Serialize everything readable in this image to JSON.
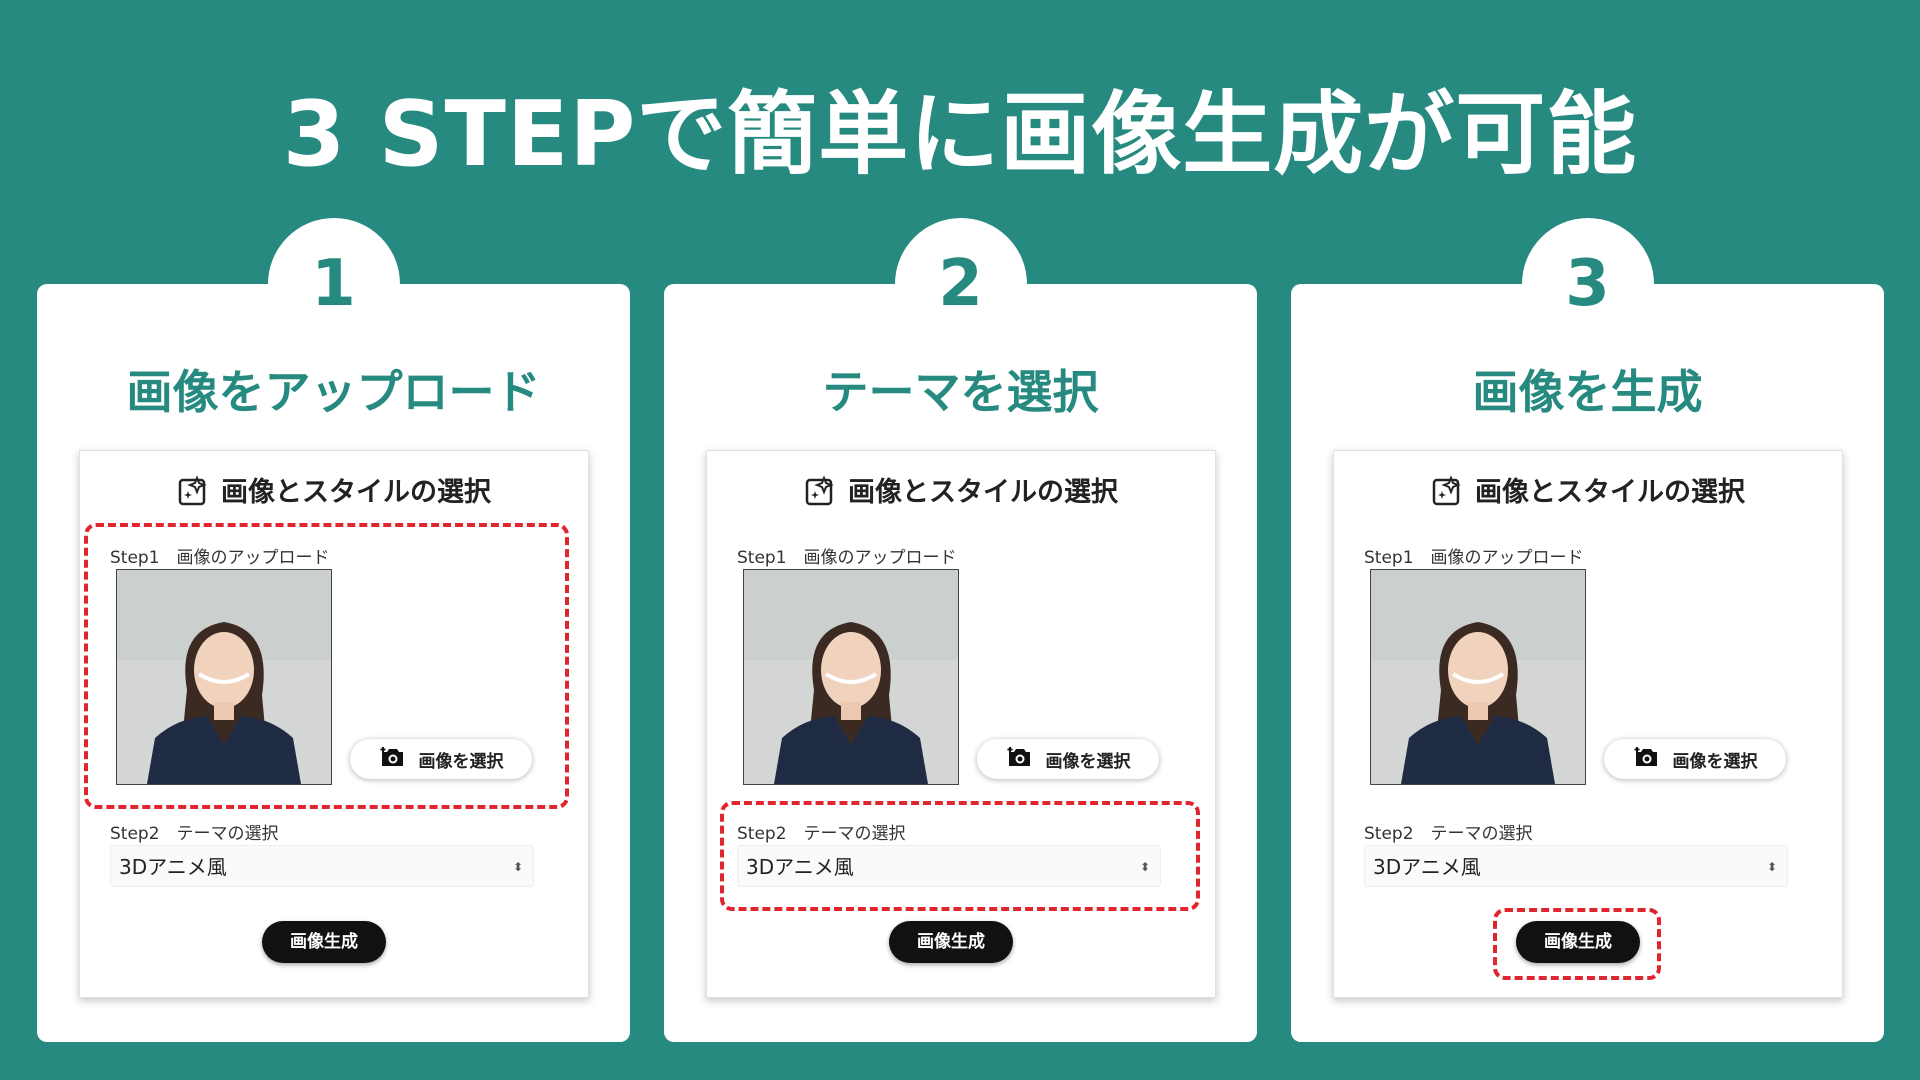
{
  "title": "3 STEPで簡単に画像生成が可能",
  "colors": {
    "background": "#278a80",
    "accent": "#278a80",
    "highlight": "#e1252e",
    "button": "#111111"
  },
  "steps": [
    {
      "number": "1",
      "heading": "画像をアップロード",
      "mock": {
        "title": "画像とスタイルの選択",
        "step1_label": "Step1　画像のアップロード",
        "upload_button": "画像を選択",
        "step2_label": "Step2　テーマの選択",
        "theme_value": "3Dアニメ風",
        "generate_button": "画像生成"
      }
    },
    {
      "number": "2",
      "heading": "テーマを選択",
      "mock": {
        "title": "画像とスタイルの選択",
        "step1_label": "Step1　画像のアップロード",
        "upload_button": "画像を選択",
        "step2_label": "Step2　テーマの選択",
        "theme_value": "3Dアニメ風",
        "generate_button": "画像生成"
      }
    },
    {
      "number": "3",
      "heading": "画像を生成",
      "mock": {
        "title": "画像とスタイルの選択",
        "step1_label": "Step1　画像のアップロード",
        "upload_button": "画像を選択",
        "step2_label": "Step2　テーマの選択",
        "theme_value": "3Dアニメ風",
        "generate_button": "画像生成"
      }
    }
  ]
}
